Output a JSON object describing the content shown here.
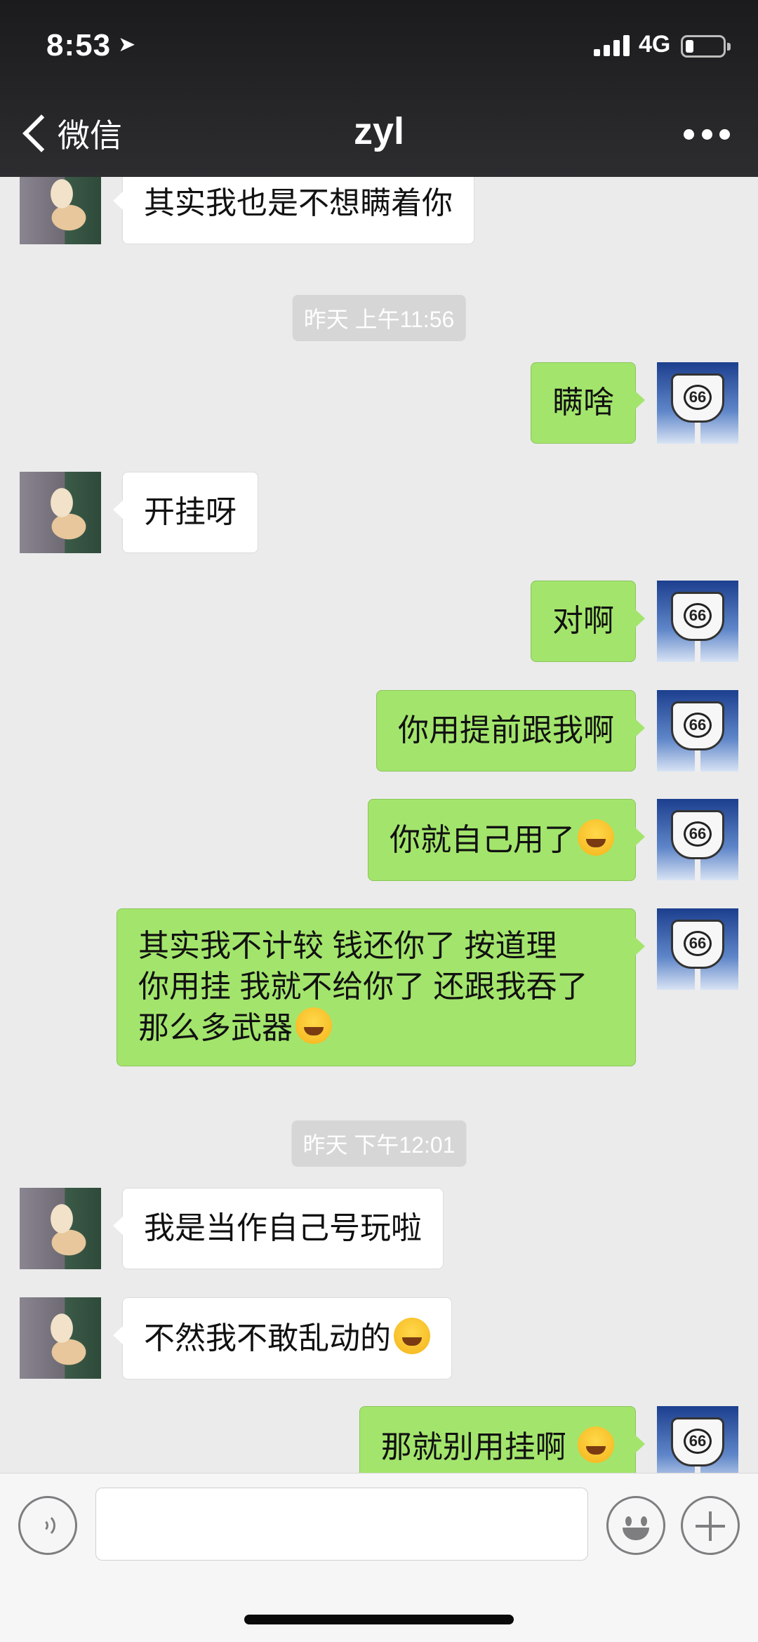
{
  "status_bar": {
    "time": "8:53",
    "location_arrow": "➤",
    "network": "4G",
    "battery_level": 0.2
  },
  "nav": {
    "back_label": "微信",
    "title": "zyl"
  },
  "messages": [
    {
      "side": "left",
      "text": "其实我也是不想瞒着你"
    },
    {
      "type": "timestamp",
      "text": "昨天 上午11:56"
    },
    {
      "side": "right",
      "text": "瞒啥"
    },
    {
      "side": "left",
      "text": "开挂呀"
    },
    {
      "side": "right",
      "text": "对啊"
    },
    {
      "side": "right",
      "text": "你用提前跟我啊"
    },
    {
      "side": "right",
      "text": "你就自己用了",
      "emoji": "facepalm-laugh-emoji"
    },
    {
      "side": "right",
      "lines": [
        "其实我不计较 钱还你了 按道理",
        "你用挂 我就不给你了 还跟我吞了",
        "那么多武器"
      ],
      "emoji": "facepalm-laugh-emoji"
    },
    {
      "type": "timestamp",
      "text": "昨天 下午12:01"
    },
    {
      "side": "left",
      "text": "我是当作自己号玩啦"
    },
    {
      "side": "left",
      "text": "不然我不敢乱动的",
      "emoji": "tears-of-joy-emoji"
    },
    {
      "side": "right",
      "text": "那就别用挂啊 ",
      "emoji": "facepalm-laugh-emoji"
    }
  ],
  "avatar_sign": {
    "number": "66"
  },
  "input_bar": {
    "value": ""
  },
  "colors": {
    "topbar": "#2a2a2c",
    "bubble_right": "#a3e56c",
    "bubble_left": "#ffffff",
    "chat_bg": "#ebebeb"
  }
}
